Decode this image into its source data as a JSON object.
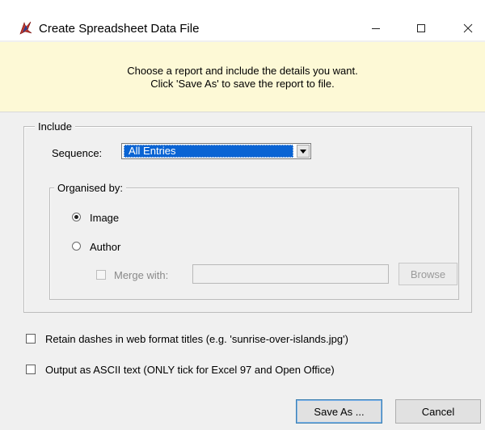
{
  "window": {
    "title": "Create Spreadsheet Data File",
    "controls": {
      "minimize": "—",
      "maximize": "☐",
      "close": "✕"
    }
  },
  "banner": {
    "line1": "Choose a report and include the details you want.",
    "line2": "Click 'Save As' to save the report to file."
  },
  "include": {
    "legend": "Include",
    "sequence_label": "Sequence:",
    "sequence_value": "All Entries",
    "organised": {
      "legend": "Organised by:",
      "options": [
        {
          "label": "Image",
          "selected": true
        },
        {
          "label": "Author",
          "selected": false
        }
      ],
      "merge_label": "Merge with:",
      "merge_value": "",
      "browse_label": "Browse"
    }
  },
  "options": {
    "retain_dashes": "Retain dashes in web format titles (e.g. 'sunrise-over-islands.jpg')",
    "ascii_text": "Output as ASCII text (ONLY tick for Excel 97 and Open Office)"
  },
  "buttons": {
    "save_as": "Save As ...",
    "cancel": "Cancel"
  },
  "icons": [
    "app-icon",
    "minimize-icon",
    "maximize-icon",
    "close-icon",
    "dropdown-arrow-icon"
  ],
  "colors": {
    "banner_bg": "#fdf9d6",
    "selection": "#0a64d4",
    "window_bg": "#f0f0f0"
  }
}
